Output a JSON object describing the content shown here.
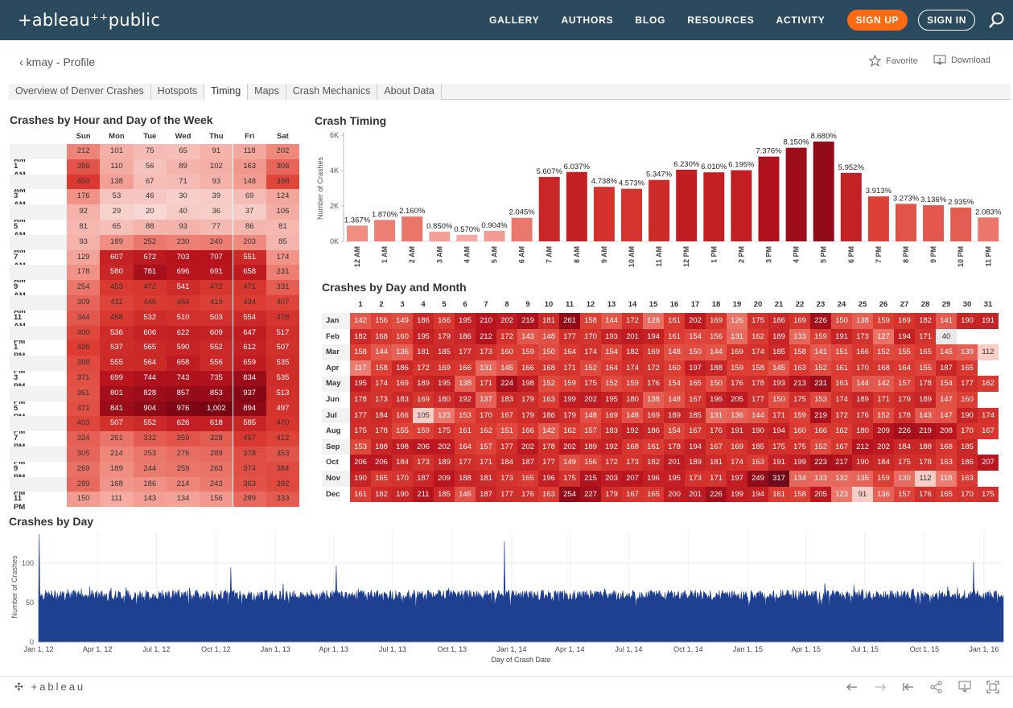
{
  "header": {
    "logo": "+ableau⁺⁺public",
    "nav": [
      "GALLERY",
      "AUTHORS",
      "BLOG",
      "RESOURCES",
      "ACTIVITY"
    ],
    "signup": "SIGN UP",
    "signin": "SIGN IN"
  },
  "profile": {
    "back_label": "kmay - Profile",
    "favorite": "Favorite",
    "download": "Download"
  },
  "tabs": [
    "Overview of Denver Crashes",
    "Hotspots",
    "Timing",
    "Maps",
    "Crash Mechanics",
    "About Data"
  ],
  "active_tab": "Timing",
  "titles": {
    "hour_day": "Crashes by Hour and Day of the Week",
    "timing": "Crash Timing",
    "day_month": "Crashes by Day and Month",
    "by_day": "Crashes by Day"
  },
  "colors": {
    "nav_bg": "#2c4a5e",
    "accent": "#ff6a13",
    "line_series": "#1f3f91"
  },
  "footer": {
    "logo": "+ableau"
  },
  "chart_data": [
    {
      "type": "heatmap",
      "title": "Crashes by Hour and Day of the Week",
      "columns": [
        "Sun",
        "Mon",
        "Tue",
        "Wed",
        "Thu",
        "Fri",
        "Sat"
      ],
      "rows": [
        "12 AM",
        "1 AM",
        "2 AM",
        "3 AM",
        "4 AM",
        "5 AM",
        "6 AM",
        "7 AM",
        "8 AM",
        "9 AM",
        "10 AM",
        "11 AM",
        "12 PM",
        "1 PM",
        "2 PM",
        "3 PM",
        "4 PM",
        "5 PM",
        "6 PM",
        "7 PM",
        "8 PM",
        "9 PM",
        "10 PM",
        "11 PM"
      ],
      "values": [
        [
          "212",
          "101",
          "75",
          "65",
          "91",
          "118",
          "202"
        ],
        [
          "356",
          "110",
          "56",
          "89",
          "102",
          "163",
          "306"
        ],
        [
          "450",
          "138",
          "67",
          "71",
          "93",
          "148",
          "398"
        ],
        [
          "176",
          "53",
          "46",
          "30",
          "39",
          "69",
          "124"
        ],
        [
          "92",
          "29",
          "20",
          "40",
          "36",
          "37",
          "106"
        ],
        [
          "81",
          "65",
          "88",
          "93",
          "77",
          "86",
          "81"
        ],
        [
          "93",
          "189",
          "252",
          "230",
          "240",
          "203",
          "85"
        ],
        [
          "129",
          "607",
          "672",
          "703",
          "707",
          "551",
          "174"
        ],
        [
          "178",
          "580",
          "781",
          "696",
          "691",
          "658",
          "231"
        ],
        [
          "254",
          "453",
          "472",
          "541",
          "472",
          "471",
          "331"
        ],
        [
          "309",
          "411",
          "446",
          "464",
          "419",
          "434",
          "407"
        ],
        [
          "344",
          "458",
          "532",
          "510",
          "503",
          "554",
          "478"
        ],
        [
          "400",
          "536",
          "606",
          "622",
          "609",
          "647",
          "517"
        ],
        [
          "435",
          "537",
          "565",
          "590",
          "552",
          "612",
          "507"
        ],
        [
          "388",
          "555",
          "564",
          "658",
          "556",
          "659",
          "535"
        ],
        [
          "371",
          "699",
          "744",
          "743",
          "735",
          "834",
          "535"
        ],
        [
          "361",
          "801",
          "828",
          "857",
          "853",
          "937",
          "513"
        ],
        [
          "371",
          "841",
          "904",
          "976",
          "1,002",
          "894",
          "497"
        ],
        [
          "403",
          "507",
          "552",
          "626",
          "618",
          "585",
          "470"
        ],
        [
          "324",
          "261",
          "332",
          "359",
          "328",
          "457",
          "412"
        ],
        [
          "305",
          "214",
          "253",
          "276",
          "289",
          "378",
          "353"
        ],
        [
          "269",
          "189",
          "244",
          "259",
          "263",
          "374",
          "384"
        ],
        [
          "289",
          "168",
          "186",
          "214",
          "243",
          "363",
          "392"
        ],
        [
          "150",
          "111",
          "143",
          "134",
          "156",
          "289",
          "333"
        ]
      ]
    },
    {
      "type": "bar",
      "title": "Crash Timing",
      "ylabel": "Number of Crashes",
      "ylim": [
        0,
        6000
      ],
      "yticks": [
        "0K",
        "2K",
        "4K",
        "6K"
      ],
      "categories": [
        "12 AM",
        "1 AM",
        "2 AM",
        "3 AM",
        "4 AM",
        "5 AM",
        "6 AM",
        "7 AM",
        "8 AM",
        "9 AM",
        "10 AM",
        "11 AM",
        "12 PM",
        "1 PM",
        "2 PM",
        "3 PM",
        "4 PM",
        "5 PM",
        "6 PM",
        "7 PM",
        "8 PM",
        "9 PM",
        "10 PM",
        "11 PM"
      ],
      "values": [
        890,
        1210,
        1400,
        550,
        370,
        590,
        1330,
        3640,
        3920,
        3080,
        2970,
        3470,
        4050,
        3900,
        4020,
        4790,
        5290,
        5640,
        3870,
        2540,
        2120,
        2040,
        1910,
        1350
      ],
      "labels": [
        "1.367%",
        "1.870%",
        "2.160%",
        "0.850%",
        "0.570%",
        "0.904%",
        "2.045%",
        "5.607%",
        "6.037%",
        "4.738%",
        "4.573%",
        "5.347%",
        "6.230%",
        "6.010%",
        "6.195%",
        "7.376%",
        "8.150%",
        "8.680%",
        "5.952%",
        "3.913%",
        "3.273%",
        "3.136%",
        "2.935%",
        "2.083%"
      ]
    },
    {
      "type": "heatmap",
      "title": "Crashes by Day and Month",
      "columns": [
        "1",
        "2",
        "3",
        "4",
        "5",
        "6",
        "7",
        "8",
        "9",
        "10",
        "11",
        "12",
        "13",
        "14",
        "15",
        "16",
        "17",
        "18",
        "19",
        "20",
        "21",
        "22",
        "23",
        "24",
        "25",
        "26",
        "27",
        "28",
        "29",
        "30",
        "31"
      ],
      "rows": [
        "Jan",
        "Feb",
        "Mar",
        "Apr",
        "May",
        "Jun",
        "Jul",
        "Aug",
        "Sep",
        "Oct",
        "Nov",
        "Dec"
      ],
      "values": [
        [
          "142",
          "156",
          "149",
          "186",
          "166",
          "195",
          "210",
          "202",
          "219",
          "181",
          "261",
          "158",
          "144",
          "172",
          "128",
          "161",
          "202",
          "169",
          "126",
          "175",
          "186",
          "169",
          "226",
          "150",
          "138",
          "159",
          "169",
          "182",
          "141",
          "190",
          "191"
        ],
        [
          "182",
          "168",
          "160",
          "195",
          "179",
          "186",
          "212",
          "172",
          "143",
          "148",
          "177",
          "170",
          "193",
          "201",
          "194",
          "161",
          "154",
          "156",
          "131",
          "162",
          "189",
          "133",
          "159",
          "191",
          "173",
          "127",
          "194",
          "171",
          "40",
          "",
          ""
        ],
        [
          "158",
          "144",
          "136",
          "181",
          "185",
          "177",
          "173",
          "160",
          "159",
          "150",
          "164",
          "174",
          "154",
          "182",
          "169",
          "148",
          "150",
          "144",
          "169",
          "174",
          "185",
          "158",
          "141",
          "151",
          "166",
          "152",
          "155",
          "165",
          "145",
          "139",
          "112"
        ],
        [
          "117",
          "158",
          "186",
          "172",
          "169",
          "166",
          "131",
          "145",
          "166",
          "168",
          "171",
          "152",
          "164",
          "174",
          "172",
          "160",
          "197",
          "188",
          "159",
          "158",
          "145",
          "163",
          "152",
          "161",
          "170",
          "168",
          "164",
          "155",
          "187",
          "165",
          ""
        ],
        [
          "195",
          "174",
          "169",
          "189",
          "195",
          "138",
          "171",
          "224",
          "198",
          "152",
          "159",
          "175",
          "152",
          "159",
          "176",
          "154",
          "165",
          "150",
          "176",
          "178",
          "193",
          "213",
          "231",
          "163",
          "144",
          "142",
          "157",
          "178",
          "154",
          "177",
          "162"
        ],
        [
          "178",
          "173",
          "183",
          "169",
          "180",
          "192",
          "137",
          "183",
          "179",
          "163",
          "199",
          "202",
          "195",
          "180",
          "138",
          "148",
          "167",
          "196",
          "205",
          "177",
          "150",
          "175",
          "153",
          "174",
          "189",
          "171",
          "179",
          "189",
          "147",
          "160",
          ""
        ],
        [
          "177",
          "184",
          "166",
          "105",
          "123",
          "153",
          "170",
          "167",
          "179",
          "186",
          "179",
          "148",
          "169",
          "148",
          "169",
          "189",
          "185",
          "131",
          "136",
          "144",
          "171",
          "159",
          "219",
          "172",
          "176",
          "152",
          "178",
          "143",
          "147",
          "190",
          "174"
        ],
        [
          "175",
          "178",
          "155",
          "159",
          "175",
          "161",
          "162",
          "151",
          "166",
          "142",
          "162",
          "157",
          "183",
          "192",
          "186",
          "154",
          "167",
          "176",
          "191",
          "190",
          "194",
          "160",
          "166",
          "162",
          "180",
          "209",
          "226",
          "219",
          "208",
          "170",
          "167"
        ],
        [
          "153",
          "188",
          "198",
          "206",
          "202",
          "164",
          "157",
          "177",
          "202",
          "178",
          "202",
          "189",
          "192",
          "168",
          "161",
          "178",
          "194",
          "167",
          "169",
          "185",
          "175",
          "175",
          "152",
          "167",
          "212",
          "202",
          "184",
          "188",
          "168",
          "185",
          ""
        ],
        [
          "206",
          "206",
          "184",
          "173",
          "189",
          "177",
          "171",
          "184",
          "187",
          "177",
          "149",
          "156",
          "172",
          "173",
          "182",
          "201",
          "189",
          "181",
          "174",
          "163",
          "191",
          "199",
          "223",
          "217",
          "190",
          "184",
          "175",
          "178",
          "163",
          "186",
          "207"
        ],
        [
          "190",
          "165",
          "170",
          "187",
          "209",
          "188",
          "181",
          "173",
          "165",
          "196",
          "175",
          "215",
          "203",
          "207",
          "196",
          "195",
          "173",
          "171",
          "197",
          "249",
          "317",
          "134",
          "133",
          "132",
          "135",
          "159",
          "130",
          "112",
          "118",
          "163",
          ""
        ],
        [
          "161",
          "182",
          "190",
          "211",
          "185",
          "146",
          "187",
          "177",
          "176",
          "163",
          "254",
          "227",
          "179",
          "167",
          "165",
          "200",
          "201",
          "226",
          "199",
          "194",
          "161",
          "158",
          "205",
          "123",
          "91",
          "136",
          "157",
          "176",
          "165",
          "170",
          "175"
        ]
      ]
    },
    {
      "type": "bar",
      "title": "Crashes by Day",
      "xlabel": "Day of Crash Date",
      "ylabel": "Number of Crashes",
      "ylim": [
        0,
        140
      ],
      "yticks": [
        "0",
        "50",
        "100"
      ],
      "xticks": [
        "Jan 1, 12",
        "Apr 1, 12",
        "Jul 1, 12",
        "Oct 1, 12",
        "Jan 1, 13",
        "Apr 1, 13",
        "Jul 1, 13",
        "Oct 1, 13",
        "Jan 1, 14",
        "Apr 1, 14",
        "Jul 1, 14",
        "Oct 1, 14",
        "Jan 1, 15",
        "Apr 1, 15",
        "Jul 1, 15",
        "Oct 1, 15",
        "Jan 1, 16"
      ],
      "x_range": [
        "2012-01-01",
        "2016-01-31"
      ],
      "typical_range": [
        40,
        75
      ],
      "spikes": [
        {
          "date": "2012-01-02",
          "value": 137
        },
        {
          "date": "2013-12-21",
          "value": 128
        },
        {
          "date": "2015-12-16",
          "value": 102
        },
        {
          "date": "2013-04-05",
          "value": 97
        },
        {
          "date": "2012-10-24",
          "value": 95
        }
      ]
    }
  ]
}
